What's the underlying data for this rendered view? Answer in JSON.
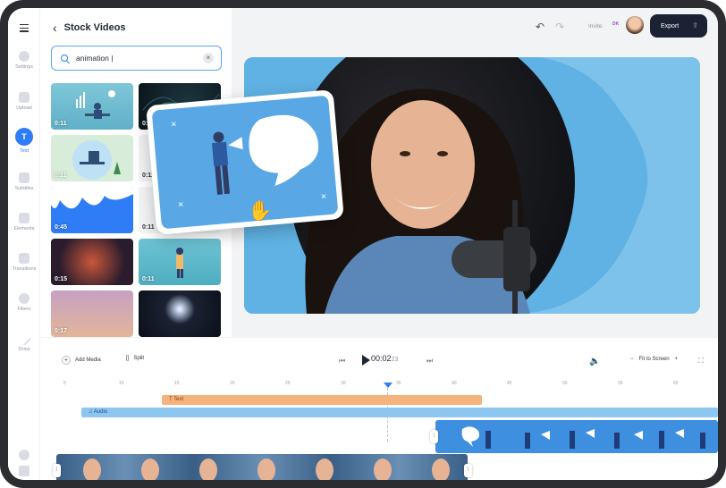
{
  "rail": {
    "items": [
      {
        "label": "Settings",
        "icon": "gear-icon"
      },
      {
        "label": "Upload",
        "icon": "upload-icon"
      },
      {
        "label": "Text",
        "icon": "text-icon",
        "glyph": "T",
        "active": true
      },
      {
        "label": "Subtitles",
        "icon": "subtitles-icon"
      },
      {
        "label": "Elements",
        "icon": "elements-icon"
      },
      {
        "label": "Transitions",
        "icon": "transitions-icon"
      },
      {
        "label": "Filters",
        "icon": "filters-icon"
      },
      {
        "label": "Draw",
        "icon": "draw-icon"
      }
    ]
  },
  "panel": {
    "title": "Stock Videos",
    "search_value": "animation |",
    "thumbs": [
      {
        "duration": "0:11"
      },
      {
        "duration": "0:11"
      },
      {
        "duration": "0:11"
      },
      {
        "duration": "0:11"
      },
      {
        "duration": "0:45"
      },
      {
        "duration": "0:11"
      },
      {
        "duration": "0:15"
      },
      {
        "duration": "0:11"
      },
      {
        "duration": "0:17"
      },
      {
        "duration": ""
      }
    ]
  },
  "topbar": {
    "invite": "Invite",
    "avatar_initials": "DK",
    "export_label": "Export"
  },
  "timeline": {
    "add_media": "Add Media",
    "split": "Split",
    "time_main": "00:02",
    "time_frac": "23",
    "fit_label": "Fit to Screen",
    "ticks": [
      "5",
      "10",
      "15",
      "20",
      "25",
      "30",
      "35",
      "40",
      "45",
      "50",
      "55",
      "60"
    ],
    "track_text_label": "T Text",
    "track_audio_label": "Audio"
  },
  "colors": {
    "accent": "#2e7df6",
    "export_bg": "#1a2233",
    "text_track": "#f6b37c",
    "audio_track": "#8ec6f2",
    "stage_bg": "#5fb2e3"
  }
}
